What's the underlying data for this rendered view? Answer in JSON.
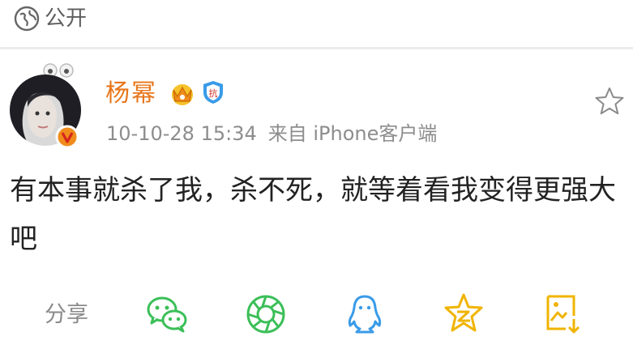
{
  "header": {
    "visibility_label": "公开",
    "visibility_icon": "globe-icon"
  },
  "post": {
    "author": {
      "name": "杨幂",
      "avatar_icon": "avatar",
      "verified_icon": "verified-badge-icon",
      "badges": [
        "crown-icon",
        "shield-badge-icon"
      ]
    },
    "timestamp": "10-10-28 15:34",
    "source": "来自 iPhone客户端",
    "text": "有本事就杀了我，杀不死，就等着看我变得更强大吧"
  },
  "share": {
    "label": "分享",
    "targets": [
      "wechat-icon",
      "moments-icon",
      "qq-icon",
      "qzone-icon",
      "save-image-icon"
    ]
  },
  "colors": {
    "author_name": "#e8761a",
    "meta": "#8d8d8d",
    "icon_green": "#3bbf58",
    "icon_blue": "#3a9be8",
    "icon_gold": "#f0b400"
  }
}
